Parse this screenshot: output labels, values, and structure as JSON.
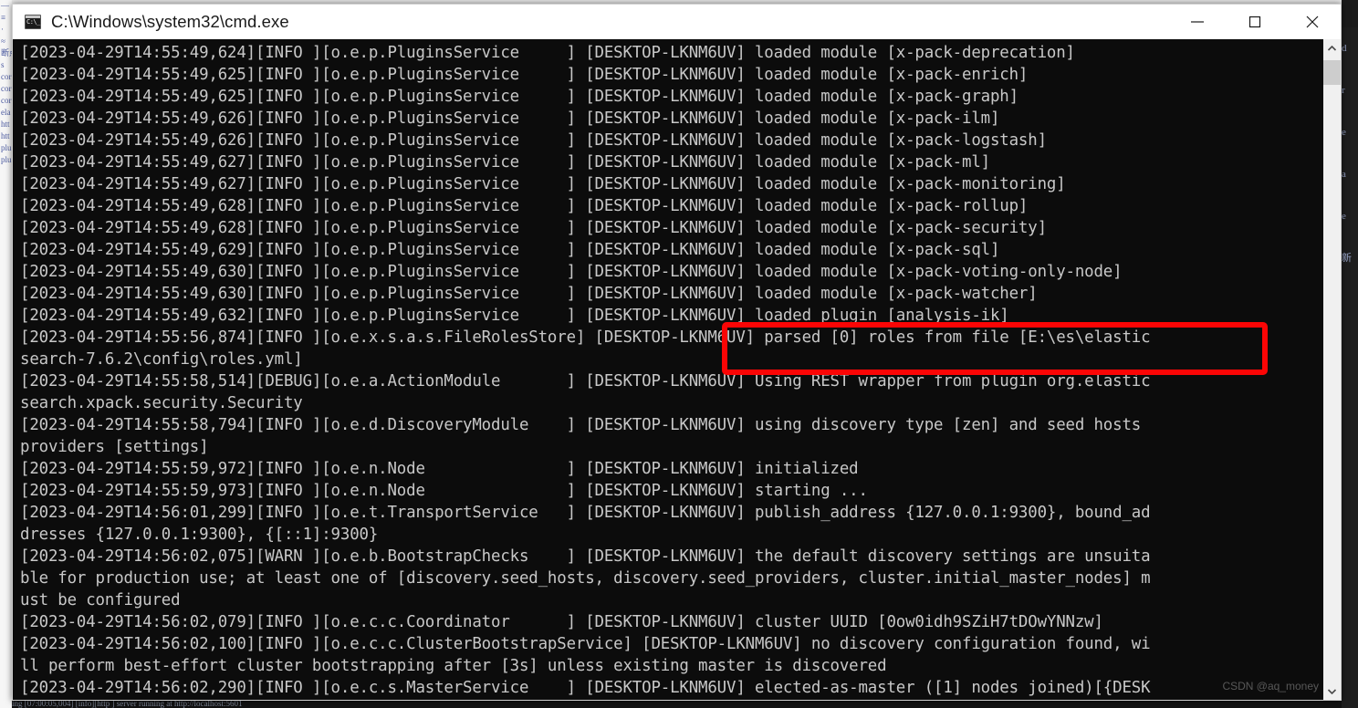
{
  "window": {
    "title": "C:\\Windows\\system32\\cmd.exe",
    "icon": "cmd-console-icon",
    "controls": {
      "minimize_label": "Minimize",
      "maximize_label": "Maximize",
      "close_label": "Close"
    }
  },
  "console": {
    "background_color": "#0c0c0c",
    "text_color": "#c8c8c8",
    "lines": [
      "[2023-04-29T14:55:49,624][INFO ][o.e.p.PluginsService     ] [DESKTOP-LKNM6UV] loaded module [x-pack-deprecation]",
      "[2023-04-29T14:55:49,625][INFO ][o.e.p.PluginsService     ] [DESKTOP-LKNM6UV] loaded module [x-pack-enrich]",
      "[2023-04-29T14:55:49,625][INFO ][o.e.p.PluginsService     ] [DESKTOP-LKNM6UV] loaded module [x-pack-graph]",
      "[2023-04-29T14:55:49,626][INFO ][o.e.p.PluginsService     ] [DESKTOP-LKNM6UV] loaded module [x-pack-ilm]",
      "[2023-04-29T14:55:49,626][INFO ][o.e.p.PluginsService     ] [DESKTOP-LKNM6UV] loaded module [x-pack-logstash]",
      "[2023-04-29T14:55:49,627][INFO ][o.e.p.PluginsService     ] [DESKTOP-LKNM6UV] loaded module [x-pack-ml]",
      "[2023-04-29T14:55:49,627][INFO ][o.e.p.PluginsService     ] [DESKTOP-LKNM6UV] loaded module [x-pack-monitoring]",
      "[2023-04-29T14:55:49,628][INFO ][o.e.p.PluginsService     ] [DESKTOP-LKNM6UV] loaded module [x-pack-rollup]",
      "[2023-04-29T14:55:49,628][INFO ][o.e.p.PluginsService     ] [DESKTOP-LKNM6UV] loaded module [x-pack-security]",
      "[2023-04-29T14:55:49,629][INFO ][o.e.p.PluginsService     ] [DESKTOP-LKNM6UV] loaded module [x-pack-sql]",
      "[2023-04-29T14:55:49,630][INFO ][o.e.p.PluginsService     ] [DESKTOP-LKNM6UV] loaded module [x-pack-voting-only-node]",
      "[2023-04-29T14:55:49,630][INFO ][o.e.p.PluginsService     ] [DESKTOP-LKNM6UV] loaded module [x-pack-watcher]",
      "[2023-04-29T14:55:49,632][INFO ][o.e.p.PluginsService     ] [DESKTOP-LKNM6UV] loaded plugin [analysis-ik]",
      "[2023-04-29T14:55:56,874][INFO ][o.e.x.s.a.s.FileRolesStore] [DESKTOP-LKNM6UV] parsed [0] roles from file [E:\\es\\elastic",
      "search-7.6.2\\config\\roles.yml]",
      "[2023-04-29T14:55:58,514][DEBUG][o.e.a.ActionModule       ] [DESKTOP-LKNM6UV] Using REST wrapper from plugin org.elastic",
      "search.xpack.security.Security",
      "[2023-04-29T14:55:58,794][INFO ][o.e.d.DiscoveryModule    ] [DESKTOP-LKNM6UV] using discovery type [zen] and seed hosts",
      "providers [settings]",
      "[2023-04-29T14:55:59,972][INFO ][o.e.n.Node               ] [DESKTOP-LKNM6UV] initialized",
      "[2023-04-29T14:55:59,973][INFO ][o.e.n.Node               ] [DESKTOP-LKNM6UV] starting ...",
      "[2023-04-29T14:56:01,299][INFO ][o.e.t.TransportService   ] [DESKTOP-LKNM6UV] publish_address {127.0.0.1:9300}, bound_ad",
      "dresses {127.0.0.1:9300}, {[::1]:9300}",
      "[2023-04-29T14:56:02,075][WARN ][o.e.b.BootstrapChecks    ] [DESKTOP-LKNM6UV] the default discovery settings are unsuita",
      "ble for production use; at least one of [discovery.seed_hosts, discovery.seed_providers, cluster.initial_master_nodes] m",
      "ust be configured",
      "[2023-04-29T14:56:02,079][INFO ][o.e.c.c.Coordinator      ] [DESKTOP-LKNM6UV] cluster UUID [0ow0idh9SZiH7tDOwYNNzw]",
      "[2023-04-29T14:56:02,100][INFO ][o.e.c.c.ClusterBootstrapService] [DESKTOP-LKNM6UV] no discovery configuration found, wi",
      "ll perform best-effort cluster bootstrapping after [3s] unless existing master is discovered",
      "[2023-04-29T14:56:02,290][INFO ][o.e.c.s.MasterService    ] [DESKTOP-LKNM6UV] elected-as-master ([1] nodes joined)[{DESK"
    ]
  },
  "annotation": {
    "type": "red-rectangle-highlight",
    "color": "#fb0505",
    "highlighted_text_1": "[DESKTOP-LKNM6UV] loaded module [x-pack-watcher]",
    "highlighted_text_2": "[DESKTOP-LKNM6UV] loaded plugin [analysis-ik]"
  },
  "scrollbar": {
    "up_arrow": "chevron-up-icon",
    "down_arrow": "chevron-down-icon",
    "thumb_position": "near-top"
  },
  "watermark": {
    "text": "CSDN @aq_money"
  },
  "background": {
    "left_fragments": [
      "—",
      "≡",
      "·",
      "≈",
      "",
      "",
      "",
      "",
      "断点",
      "s",
      "cor",
      "cor",
      "cor",
      "ela",
      "htt",
      "htt",
      "plu",
      "plu"
    ],
    "right_fragments": [
      "d",
      "r",
      "",
      "e",
      "",
      "",
      "",
      "",
      "",
      "",
      "a",
      "e",
      "",
      "",
      "新"
    ],
    "bottom_fragment": "    ing  [07:00:05,004] [info][http   ] server running at http://localhost:5601"
  }
}
